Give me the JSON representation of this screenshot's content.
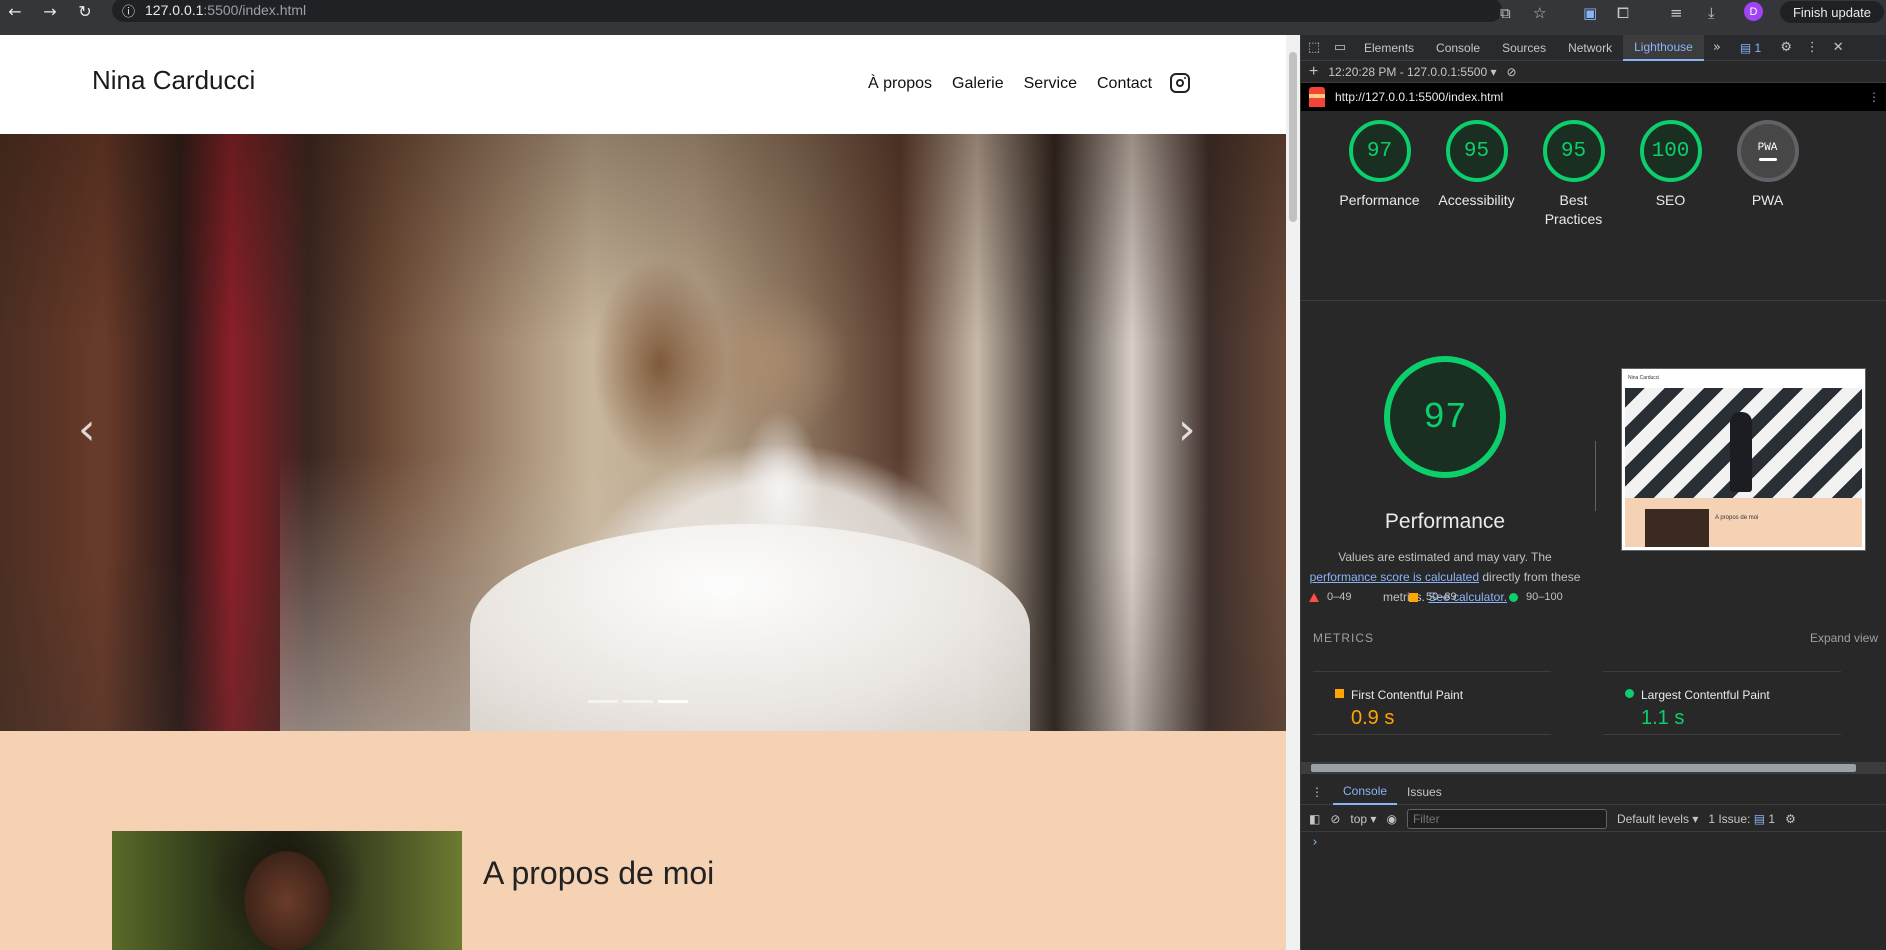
{
  "browser": {
    "url_host": "127.0.0.1",
    "url_path": ":5500/index.html",
    "finish_update": "Finish update",
    "avatar_letter": "D"
  },
  "site": {
    "brand": "Nina Carducci",
    "nav": [
      "À propos",
      "Galerie",
      "Service",
      "Contact"
    ],
    "about_title": "A propos de moi"
  },
  "devtools": {
    "tabs": [
      "Elements",
      "Console",
      "Sources",
      "Network",
      "Lighthouse"
    ],
    "issues_badge": "1",
    "report_selector": "12:20:28 PM - 127.0.0.1:5500",
    "report_url": "http://127.0.0.1:5500/index.html",
    "scores": [
      {
        "label": "Performance",
        "value": "97"
      },
      {
        "label": "Accessibility",
        "value": "95"
      },
      {
        "label": "Best Practices",
        "value": "95"
      },
      {
        "label": "SEO",
        "value": "100"
      },
      {
        "label": "PWA",
        "value": "PWA"
      }
    ],
    "main_score": "97",
    "main_title": "Performance",
    "desc_1": "Values are estimated and may vary. The",
    "desc_link": "performance score is calculated",
    "desc_2": "directly from these metrics.",
    "desc_link2": "See calculator.",
    "legend": [
      "0–49",
      "50–89",
      "90–100"
    ],
    "metrics_label": "METRICS",
    "expand_view": "Expand view",
    "metrics": [
      {
        "name": "First Contentful Paint",
        "value": "0.9 s",
        "color": "#ffa400"
      },
      {
        "name": "Largest Contentful Paint",
        "value": "1.1 s",
        "color": "#0cce6b"
      }
    ],
    "screenshot": {
      "brand": "Nina Carducci",
      "section_title": "A propos de moi"
    },
    "drawer_tabs": [
      "Console",
      "Issues"
    ],
    "console": {
      "context": "top",
      "filter_placeholder": "Filter",
      "levels": "Default levels",
      "issues_text": "1 Issue:",
      "issues_count": "1"
    }
  }
}
